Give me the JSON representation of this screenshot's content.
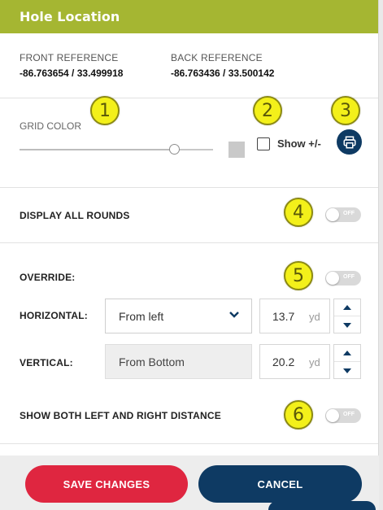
{
  "header": {
    "title": "Hole Location"
  },
  "references": {
    "front": {
      "label": "FRONT REFERENCE",
      "value": "-86.763654 / 33.499918"
    },
    "back": {
      "label": "BACK REFERENCE",
      "value": "-86.763436 / 33.500142"
    }
  },
  "grid": {
    "label": "GRID COLOR",
    "slider_value_fraction": 0.8,
    "swatch_color": "#c9c9c9",
    "show_plus_minus": {
      "label": "Show +/-",
      "checked": false
    },
    "print_icon": "printer-icon"
  },
  "display_all_rounds": {
    "label": "DISPLAY ALL ROUNDS",
    "toggle_text": "OFF",
    "on": false
  },
  "override": {
    "label": "OVERRIDE:",
    "toggle_text": "OFF",
    "on": false,
    "horizontal": {
      "label": "HORIZONTAL:",
      "select": "From left",
      "value": "13.7",
      "unit": "yd"
    },
    "vertical": {
      "label": "VERTICAL:",
      "select": "From Bottom",
      "value": "20.2",
      "unit": "yd"
    }
  },
  "show_both": {
    "label": "SHOW BOTH LEFT AND RIGHT DISTANCE",
    "toggle_text": "OFF",
    "on": false
  },
  "footer": {
    "save_label": "SAVE CHANGES",
    "cancel_label": "CANCEL"
  },
  "badges": [
    "1",
    "2",
    "3",
    "4",
    "5",
    "6"
  ],
  "colors": {
    "header": "#a5b632",
    "save": "#df2640",
    "navy": "#0e3a63",
    "badge": "#f3f01a"
  }
}
